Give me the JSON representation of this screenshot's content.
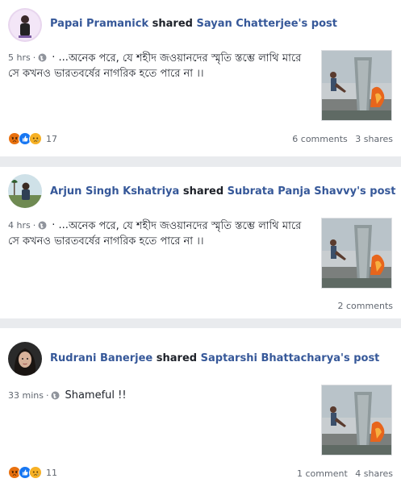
{
  "posts": [
    {
      "sharer": "Papai Pramanick",
      "verb": "shared",
      "original_author": "Sayan Chatterjee's post",
      "time": "5 hrs",
      "separator": "·",
      "text_prefix": "· ...",
      "text": "অনেক পরে, যে শহীদ জওয়ানদের স্মৃতি স্তম্ভে লাথি মারে সে কখনও ভারতবর্ষের নাগরিক হতে পারে না ।।",
      "reaction_count": "17",
      "comments": "6 comments",
      "shares": "3 shares",
      "reaction_icons": [
        "angry-icon",
        "like-icon",
        "sad-icon"
      ]
    },
    {
      "sharer": "Arjun Singh Kshatriya",
      "verb": "shared",
      "original_author": "Subrata Panja Shavvy's post",
      "time": "4 hrs",
      "separator": "·",
      "text_prefix": "· ...",
      "text": "অনেক পরে, যে শহীদ জওয়ানদের স্মৃতি স্তম্ভে লাথি মারে সে কখনও ভারতবর্ষের নাগরিক হতে পারে না ।।",
      "comments": "2 comments"
    },
    {
      "sharer": "Rudrani Banerjee",
      "verb": "shared",
      "original_author": "Saptarshi Bhattacharya's post",
      "time": "33 mins",
      "separator": "·",
      "text": "Shameful !!",
      "reaction_count": "11",
      "comments": "1 comment",
      "shares": "4 shares",
      "reaction_icons": [
        "angry-icon",
        "like-icon",
        "sad-icon"
      ]
    }
  ],
  "colors": {
    "link": "#365899",
    "meta": "#616770",
    "background": "#e9ebee",
    "like": "#1877f2",
    "angry": "#e9710f",
    "sad": "#f7b125"
  }
}
